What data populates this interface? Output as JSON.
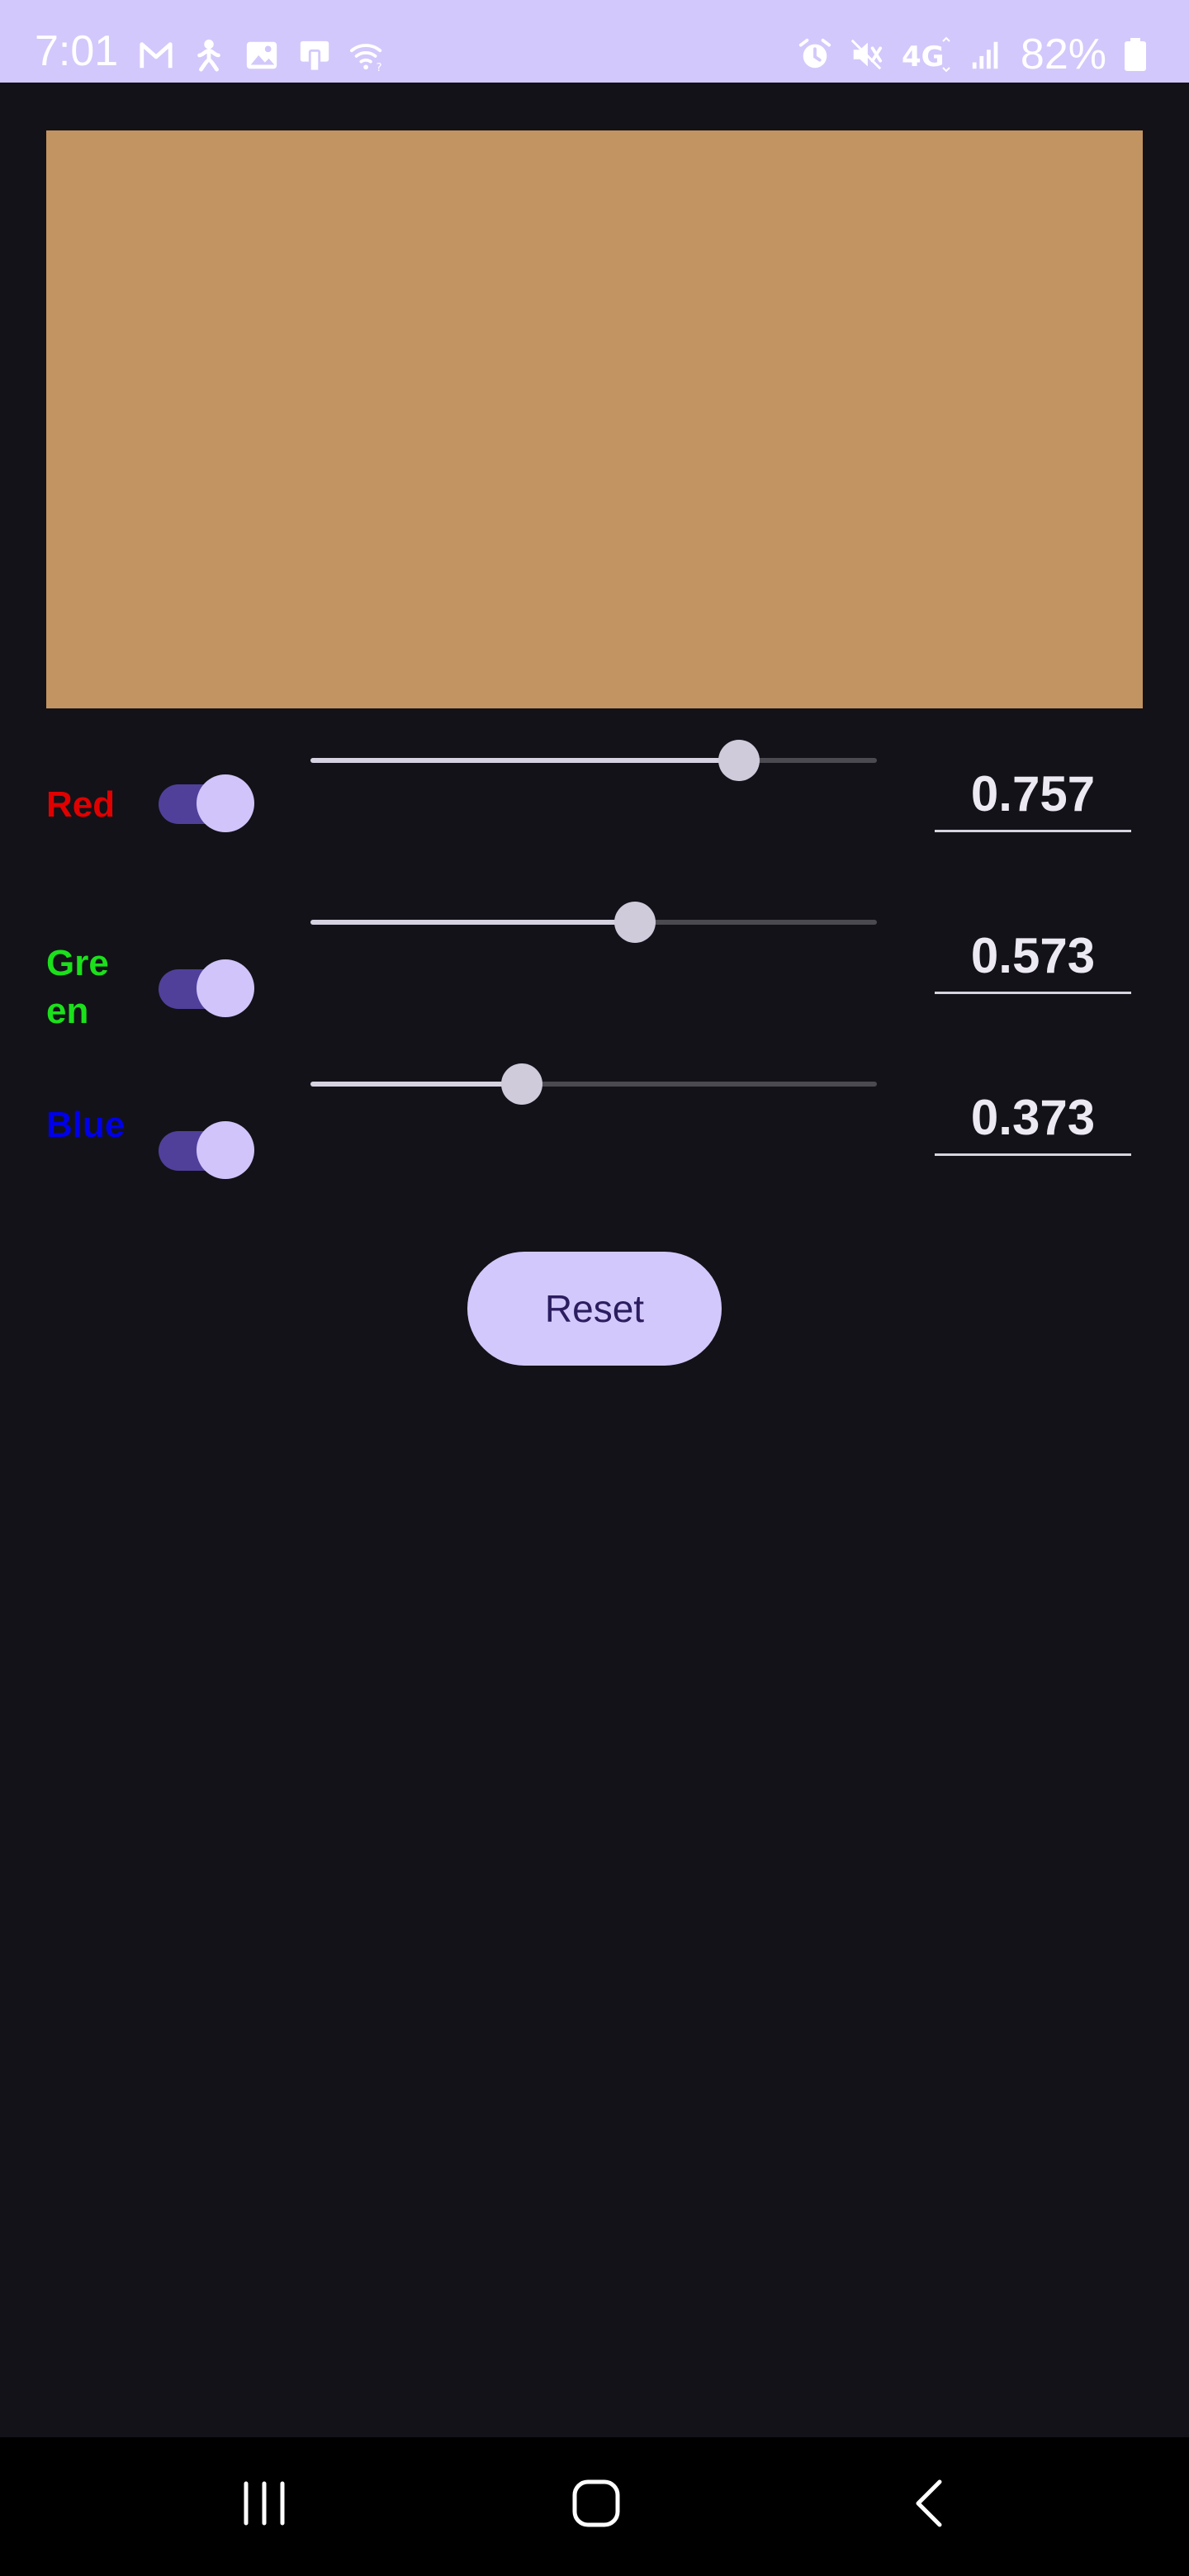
{
  "status_bar": {
    "time": "7:01",
    "battery": "82%",
    "left_icons": [
      "gmail-icon",
      "accessibility-icon",
      "gallery-icon",
      "cast-icon",
      "wifi-question-icon"
    ],
    "right_icons": [
      "alarm-icon",
      "mute-icon",
      "4g-icon",
      "signal-icon"
    ]
  },
  "preview": {
    "color": "#c29461"
  },
  "channels": [
    {
      "label": "Red",
      "color": "#e00000",
      "enabled": true,
      "value": 0.757,
      "value_text": "0.757"
    },
    {
      "label": "Green",
      "color": "#1be01b",
      "enabled": true,
      "value": 0.573,
      "value_text": "0.573"
    },
    {
      "label": "Blue",
      "color": "#0000e8",
      "enabled": true,
      "value": 0.373,
      "value_text": "0.373"
    }
  ],
  "reset_button": {
    "label": "Reset"
  },
  "nav_bar": {
    "items": [
      "recent-apps-icon",
      "home-icon",
      "back-icon"
    ]
  },
  "theme": {
    "accent": "#d3c8fb",
    "switch_track": "#50409a",
    "background": "#131218"
  }
}
